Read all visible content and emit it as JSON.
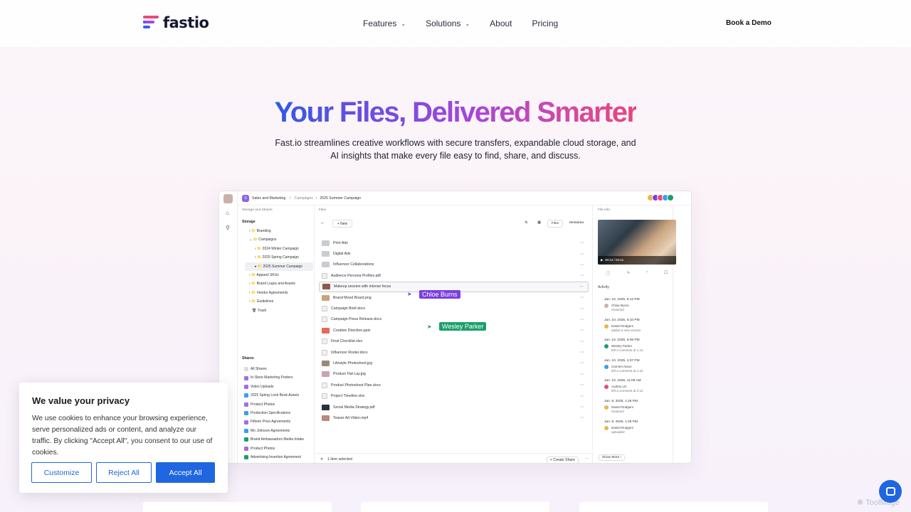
{
  "nav": {
    "logo": "fastio",
    "menu": [
      "Features",
      "Solutions",
      "About",
      "Pricing"
    ],
    "cta": "Book a Demo"
  },
  "hero": {
    "title": "Your Files, Delivered Smarter",
    "subtitle": "Fast.io streamlines creative workflows with secure transfers, expandable cloud storage, and AI insights that make every file easy to find, share, and discuss."
  },
  "app": {
    "workspace": "Sales and Marketing",
    "breadcrumb": [
      "Campaigns",
      "2025 Summer Campaign"
    ],
    "left_header": "Storage and Shares",
    "storage_label": "Storage",
    "tree": [
      "Branding",
      "Campaigns",
      "2024 Winter Campaign",
      "2025 Spring Campaign",
      "2025 Summer Campaign",
      "Apparel SKUs",
      "Brand Logos and Assets",
      "Vendor Agreements",
      "Guidelines",
      "Trash"
    ],
    "shares_label": "Shares",
    "shares": [
      "All Shares",
      "In-Store Marketing Posters",
      "Video Uploads",
      "2025 Spring Look Book Assets",
      "Product Photos",
      "Production Specifications",
      "Fifteen Price Agreements",
      "Mo Johnson Agreements",
      "Brand Ambassadors Media Intake",
      "Product Photos",
      "Advertising Insertion Agreement"
    ],
    "files_header": "Files",
    "new_label": "New",
    "tab_files": "Files",
    "tab_metadata": "Metadata",
    "files": [
      "Print Ads",
      "Digital Ads",
      "Influencer Collaborations",
      "Audience Persona Profiles.pdf",
      "Makeup session with intense focus",
      "Brand Mood Board.png",
      "Campaign Brief.docx",
      "Campaign Press Release.docx",
      "Creative Direction.pptx",
      "Final Checklist.xlsx",
      "Influencer Roster.docx",
      "Lifestyle Photoshoot.jpg",
      "Product Flat Lay.jpg",
      "Product Photoshoot Plan.docx",
      "Project Timeline.xlsx",
      "Social Media Strategy.pdf",
      "Teaser Ad Video.mp4"
    ],
    "cursor_1": "Chloe Burns",
    "cursor_2": "Wesley Parker",
    "selected_count": "1 item selected",
    "create_share": "Create Share",
    "info_header": "File Info",
    "video_time": "00:24 / 03:41",
    "activity_label": "Activity",
    "activity": [
      {
        "date": "Jan. 10, 2025, 6:12 PM",
        "name": "Chloe Burns",
        "text": "renamed"
      },
      {
        "date": "Jan. 10, 2025, 6:10 PM",
        "name": "Daniel Rodgers",
        "text": "added a new version"
      },
      {
        "date": "Jan. 10, 2025, 6:05 PM",
        "name": "Wesley Parker",
        "text": "left a comment at 1:41"
      },
      {
        "date": "Jan. 10, 2025, 4:37 PM",
        "name": "Carmen Nixon",
        "text": "left a comment at 1:42"
      },
      {
        "date": "Jan. 10, 2025, 11:09 AM",
        "name": "Audrey Lin",
        "text": "left a comment at 2:12"
      },
      {
        "date": "Jan. 8, 2025, 1:26 PM",
        "name": "Daniel Rodgers",
        "text": "renamed"
      },
      {
        "date": "Jan. 8, 2025, 1:26 PM",
        "name": "Daniel Rodgers",
        "text": "uploaded"
      }
    ],
    "show_more": "Show More"
  },
  "cookie": {
    "title": "We value your privacy",
    "body": "We use cookies to enhance your browsing experience, serve personalized ads or content, and analyze our traffic. By clicking \"Accept All\", you consent to our use of cookies.",
    "customize": "Customize",
    "reject": "Reject All",
    "accept": "Accept All"
  },
  "watermark": "ToolMage",
  "colors": {
    "accent": "#1f66e0",
    "cursor_1": "#7a3fe0",
    "cursor_2": "#19a06a"
  }
}
